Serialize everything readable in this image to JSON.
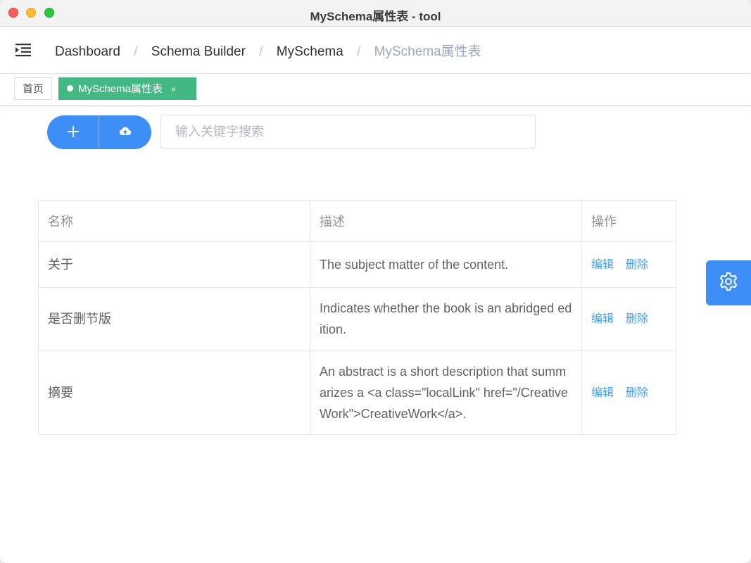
{
  "window": {
    "title": "MySchema属性表 - tool"
  },
  "navbar": {
    "breadcrumb": [
      "Dashboard",
      "Schema Builder",
      "MySchema",
      "MySchema属性表"
    ],
    "separator": "/"
  },
  "tags": {
    "home": "首页",
    "active": "MySchema属性表",
    "close": "×"
  },
  "toolbar": {
    "search_placeholder": "输入关键字搜索",
    "add_icon": "plus-icon",
    "upload_icon": "cloud-upload-icon"
  },
  "table": {
    "headers": [
      "名称",
      "描述",
      "操作"
    ],
    "rows": [
      {
        "name": "关于",
        "description": "The subject matter of the content.",
        "edit": "编辑",
        "delete": "删除"
      },
      {
        "name": "是否删节版",
        "description": "Indicates whether the book is an abridged edition.",
        "edit": "编辑",
        "delete": "删除"
      },
      {
        "name": "摘要",
        "description": "An abstract is a short description that summarizes a <a class=\"localLink\" href=\"/CreativeWork\">CreativeWork</a>.",
        "edit": "编辑",
        "delete": "删除"
      }
    ]
  },
  "colors": {
    "primary": "#3d8ef7",
    "tag_active": "#42b983",
    "link": "#409eff"
  },
  "settings": {
    "icon": "gear-icon"
  }
}
